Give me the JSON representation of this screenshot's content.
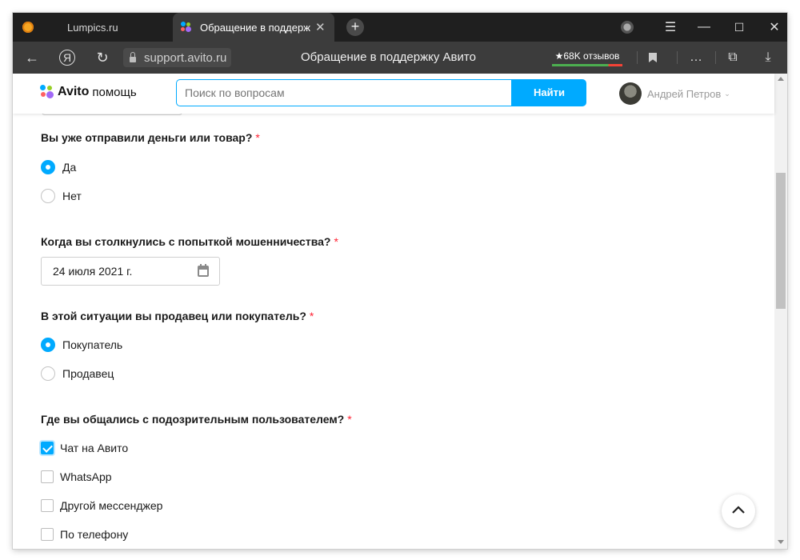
{
  "browser": {
    "tabs": [
      {
        "label": "Lumpics.ru",
        "active": false
      },
      {
        "label": "Обращение в поддерж",
        "active": true
      }
    ],
    "url": "support.avito.ru",
    "page_title": "Обращение в поддержку Авито",
    "reviews_badge": "★68K отзывов"
  },
  "site": {
    "brand": "Avito",
    "brand_suffix": "помощь",
    "search_placeholder": "Поиск по вопросам",
    "search_button": "Найти",
    "user_name": "Андрей Петров"
  },
  "form": {
    "q1": {
      "label": "Вы уже отправили деньги или товар?",
      "options": [
        "Да",
        "Нет"
      ],
      "selected": "Да"
    },
    "q2": {
      "label": "Когда вы столкнулись с попыткой мошенничества?",
      "value": "24 июля 2021 г."
    },
    "q3": {
      "label": "В этой ситуации вы продавец или покупатель?",
      "options": [
        "Покупатель",
        "Продавец"
      ],
      "selected": "Покупатель"
    },
    "q4": {
      "label": "Где вы общались с подозрительным пользователем?",
      "options": [
        "Чат на Авито",
        "WhatsApp",
        "Другой мессенджер",
        "По телефону"
      ],
      "checked": [
        "Чат на Авито"
      ]
    },
    "required_mark": "*"
  },
  "colors": {
    "accent": "#00aaff",
    "required": "#ff2233",
    "browser_dark": "#1f1f1f",
    "browser_bar": "#3c3c3c"
  }
}
